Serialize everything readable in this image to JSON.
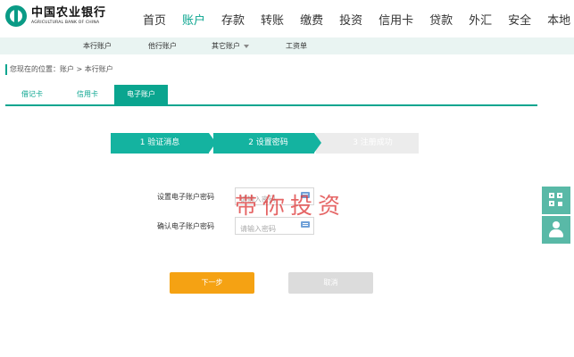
{
  "brand": {
    "name_cn": "中国农业银行",
    "name_en": "AGRICULTURAL BANK OF CHINA"
  },
  "main_nav": [
    "首页",
    "账户",
    "存款",
    "转账",
    "缴费",
    "投资",
    "信用卡",
    "贷款",
    "外汇",
    "安全",
    "本地"
  ],
  "main_nav_active": "账户",
  "sub_nav": [
    "本行账户",
    "他行账户",
    "其它账户",
    "工资单"
  ],
  "breadcrumb": "您现在的位置：账户 > 本行账户",
  "tabs": [
    "借记卡",
    "信用卡",
    "电子账户"
  ],
  "active_tab": "电子账户",
  "steps": [
    "1 验证消息",
    "2 设置密码",
    "3 注册成功"
  ],
  "current_step": 2,
  "form": {
    "set_password_label": "设置电子账户密码",
    "set_password_placeholder": "请输入密码",
    "confirm_password_label": "确认电子账户密码",
    "confirm_password_placeholder": "请输入密码"
  },
  "buttons": {
    "next": "下一步",
    "cancel": "取消"
  },
  "watermark": "带你投资",
  "colors": {
    "accent": "#0aa58f",
    "step_done": "#14b3a0",
    "step_todo": "#ececec",
    "next_button": "#f5a213",
    "cancel_button": "#dcdcdc",
    "side_tool": "#59b9a7",
    "watermark": "#dc3232"
  },
  "side_tools": [
    "qr-code-icon",
    "user-service-icon"
  ]
}
